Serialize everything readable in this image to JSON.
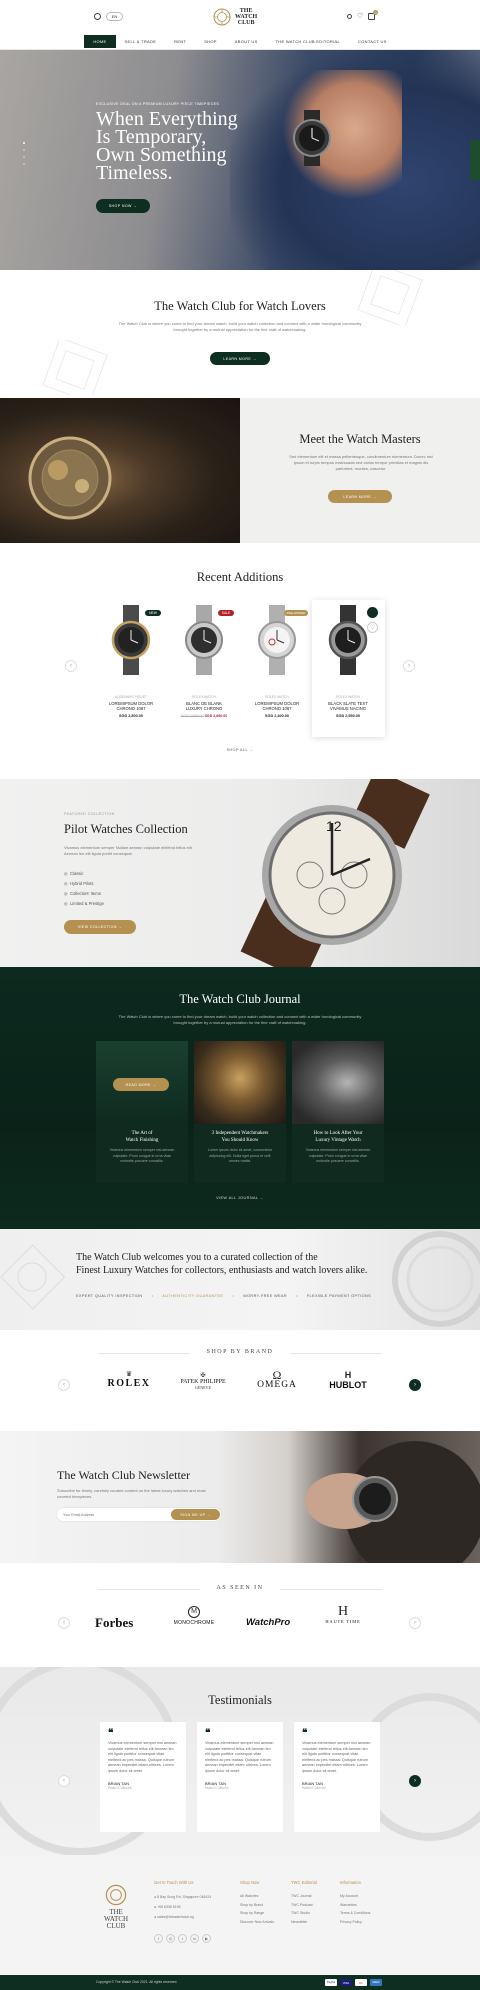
{
  "header": {
    "lang": "EN",
    "logo_line1": "THE",
    "logo_line2": "WATCH",
    "logo_line3": "CLUB",
    "cart_count": "0",
    "nav": [
      "HOME",
      "SELL & TRADE",
      "RENT",
      "SHOP",
      "ABOUT US",
      "THE WATCH CLUB EDITORIAL",
      "CONTACT US"
    ]
  },
  "hero": {
    "kicker": "EXCLUSIVE DEAL ON A PREMIUM LUXURY PIECE TIMEPIECES",
    "line1": "When Everything",
    "line2": "Is Temporary,",
    "line3": "Own Something",
    "line4": "Timeless.",
    "cta": "SHOP NOW"
  },
  "lovers": {
    "title": "The Watch Club for Watch Lovers",
    "text": "The Watch Club is where you come to find your dream watch, build your watch collection and connect with a wider horological community brought together by a mutual appreciation for the fine craft of watchmaking.",
    "cta": "LEARN MORE"
  },
  "masters": {
    "title": "Meet the Watch Masters",
    "text": "Sed elementum elit et massa pellentesque, condimentum elementum. Donec nisi ipsum et turpis tempus malesuada sed varius tempor primitias et magnis dis parturient, montes, nascetur.",
    "cta": "LEARN MORE"
  },
  "recent": {
    "title": "Recent Additions",
    "products": [
      {
        "brand": "AUDEMARS PIGUET",
        "name1": "LOREMIPSUM DOLOR",
        "name2": "CHRONO 1067",
        "price": "SGD 2,800.00",
        "old": "",
        "badge": "NEW"
      },
      {
        "brand": "ROLEX WATCH",
        "name1": "BLANC DE BLANK",
        "name2": "LUXURY CHRONO",
        "price": "SGD 2,890.00",
        "old": "SGD 3,650.00",
        "badge": "SALE"
      },
      {
        "brand": "ROLEX WATCH",
        "name1": "LOREMIPSUM DOLOR",
        "name2": "CHRONO 1067",
        "price": "SGD 2,400.00",
        "old": "",
        "badge": "PRE-OWNED"
      },
      {
        "brand": "ROLEX WATCH",
        "name1": "BLACK SLATE TEXT",
        "name2": "VIVAMUS NACING",
        "price": "SGD 2,950.00",
        "old": "",
        "badge": ""
      }
    ],
    "shop_all": "SHOP ALL"
  },
  "pilot": {
    "kicker": "FEATURED COLLECTION",
    "title": "Pilot Watches Collection",
    "text": "Vivamus elementum semper Nullam aenean vulputate eleifend tellus elit Aenean leo elit ligula porttit consequat.",
    "features": [
      "Classic",
      "Hybrid Pilots",
      "Collectors' Items",
      "Limited & Prestige"
    ],
    "cta": "VIEW COLLECTION"
  },
  "journal": {
    "title": "The Watch Club Journal",
    "text": "The Watch Club is where you come to find your dream watch, build your watch collection and connect with a wider horological community brought together by a mutual appreciation for the fine craft of watchmaking.",
    "read_more": "READ MORE",
    "posts": [
      {
        "t1": "The Art of",
        "t2": "Watch Finishing",
        "body": "Vivamus elementum semper nisi aenean vulputate. Proin congue in urna vitae molestie posuere convallis."
      },
      {
        "t1": "3 Independent Watchmakers",
        "t2": "You Should Know",
        "body": "Lorem ipsum dolor sit amet, consectetur adipiscing elit. Nulla eget purus et velit omnes mattis."
      },
      {
        "t1": "How to Look After Your",
        "t2": "Luxury Vintage Watch",
        "body": "Vivamus elementum semper nisi aenean vulputate. Proin congue in urna vitae molestie posuere convallis."
      }
    ],
    "view_all": "VIEW ALL JOURNAL"
  },
  "welcome": {
    "line1": "The Watch Club welcomes you to a curated collection of the",
    "line2": "Finest Luxury Watches for collectors, enthusiasts and watch lovers alike.",
    "features": [
      "EXPERT QUALITY INSPECTION",
      "AUTHENTICITY GUARANTEE",
      "WORRY-FREE WEAR",
      "FLEXIBLE PAYMENT OPTIONS"
    ]
  },
  "brands": {
    "title": "SHOP BY BRAND",
    "items": [
      "ROLEX",
      "PATEK PHILIPPE",
      "OMEGA",
      "HUBLOT"
    ],
    "patek_sub": "GENEVE"
  },
  "newsletter": {
    "title": "The Watch Club Newsletter",
    "text": "Subscribe for timely, carefully curated content on the latest luxury watches and most coveted timepieces.",
    "placeholder": "Your Email Address",
    "cta": "SIGN ME UP"
  },
  "seen": {
    "title": "AS SEEN IN",
    "items": [
      "Forbes",
      "MONOCHROME",
      "WatchPro",
      "HAUTE TIME"
    ]
  },
  "testimonials": {
    "title": "Testimonials",
    "items": [
      {
        "text": "Vivamus elementum semper nisi aenean vulputate eleifend tellus elit Aenean leo elit ligula porttitor consequat vitae eleifend ac pes massa. Quisque rutrum aenean imperdiet etiam ultrices. Lorem ipsum dolor sit amet.",
        "name": "BRIAN TAN",
        "role": "Watch Collector"
      },
      {
        "text": "Vivamus elementum semper nisi aenean vulputate eleifend tellus elit Aenean leo elit ligula porttitor consequat vitae eleifend ac pes massa. Quisque rutrum aenean imperdiet etiam ultrices. Lorem ipsum dolor sit amet.",
        "name": "BRIAN TAN",
        "role": "Watch Collector"
      },
      {
        "text": "Vivamus elementum semper nisi aenean vulputate eleifend tellus elit Aenean leo elit ligula porttitor consequat vitae eleifend ac pes massa. Quisque rutrum aenean imperdiet etiam ultrices. Lorem ipsum dolor sit amet.",
        "name": "BRIAN TAN",
        "role": "Watch Collector"
      }
    ]
  },
  "footer": {
    "contact_title": "Get In Touch With Us",
    "address": "8 Bay Sung Rd, Singapore 048424",
    "phone": "+65 6338 8195",
    "email": "sales@thewatchclub.sg",
    "col1_title": "Shop Now",
    "col1": [
      "All Watches",
      "Shop by Brand",
      "Shop by Range",
      "Discover New Arrivals"
    ],
    "col2_title": "TWC Editorial",
    "col2": [
      "TWC Journal",
      "TWC Podcast",
      "TWC Studio",
      "Newsletter"
    ],
    "col3_title": "Information",
    "col3": [
      "My Account",
      "Warranties",
      "Terms & Conditions",
      "Privacy Policy"
    ],
    "copyright": "Copyright © The Watch Club 2021. All rights reserved.",
    "payments": [
      "PayPal",
      "VISA",
      "MC",
      "AMEX"
    ]
  },
  "colors": {
    "green": "#0e2e22",
    "gold": "#b49150",
    "sale": "#b0222a"
  }
}
